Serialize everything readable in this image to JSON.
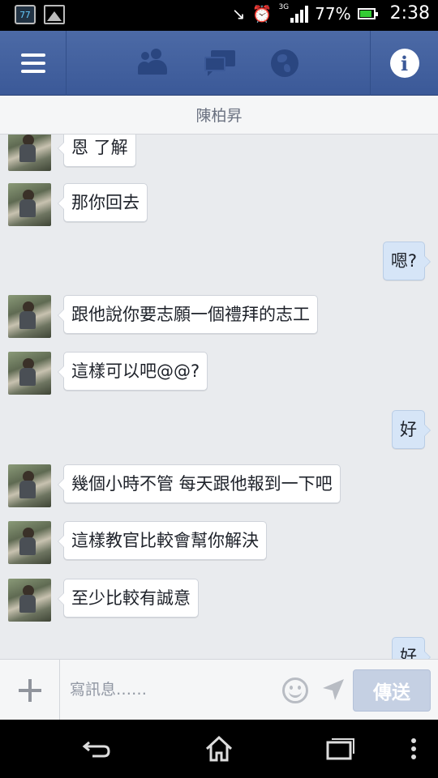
{
  "status_bar": {
    "notif_badge": "77",
    "network": "3G",
    "battery_pct": "77%",
    "time": "2:38"
  },
  "nav": {
    "menu_icon": "hamburger-icon",
    "tabs": [
      "friends-icon",
      "messages-icon",
      "globe-icon"
    ],
    "info_icon": "info-icon"
  },
  "conversation": {
    "title": "陳柏昇",
    "messages": [
      {
        "dir": "in",
        "text": "恩 了解"
      },
      {
        "dir": "in",
        "text": "那你回去"
      },
      {
        "dir": "out",
        "text": "嗯?"
      },
      {
        "dir": "in",
        "text": "跟他說你要志願一個禮拜的志工"
      },
      {
        "dir": "in",
        "text": "這樣可以吧@@?"
      },
      {
        "dir": "out",
        "text": "好"
      },
      {
        "dir": "in",
        "text": "幾個小時不管 每天跟他報到一下吧"
      },
      {
        "dir": "in",
        "text": "這樣教官比較會幫你解決"
      },
      {
        "dir": "in",
        "text": "至少比較有誠意"
      },
      {
        "dir": "out",
        "text": "好"
      }
    ]
  },
  "composer": {
    "placeholder": "寫訊息……",
    "send_label": "傳送"
  },
  "colors": {
    "nav_blue": "#3b5998",
    "chat_bg": "#e9ebee",
    "outgoing_bubble": "#d6e5f7",
    "send_disabled": "#c5d0e3"
  }
}
